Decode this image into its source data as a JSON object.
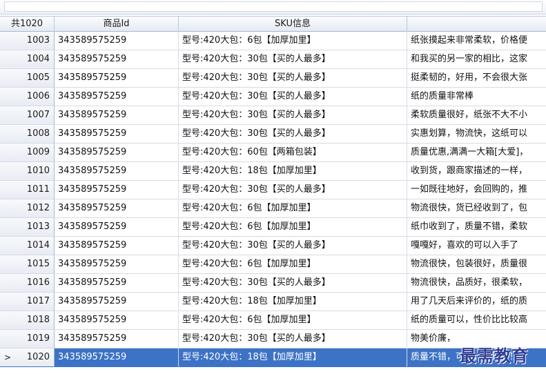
{
  "header": {
    "corner": "共1020",
    "columns": [
      "商品Id",
      "SKU信息",
      ""
    ]
  },
  "selected_row_marker": ">",
  "rows": [
    {
      "idx": "1003",
      "product_id": "343589575259",
      "sku": "型号:420大包：6包【加厚加里】",
      "comment": "纸张摸起来非常柔软，价格便"
    },
    {
      "idx": "1004",
      "product_id": "343589575259",
      "sku": "型号:420大包：30包【买的人最多】",
      "comment": "和我买的另一家的相比，这家"
    },
    {
      "idx": "1005",
      "product_id": "343589575259",
      "sku": "型号:420大包：30包【买的人最多】",
      "comment": "挺柔韧的，好用，不会很大张"
    },
    {
      "idx": "1006",
      "product_id": "343589575259",
      "sku": "型号:420大包：30包【买的人最多】",
      "comment": "纸的质量非常棒"
    },
    {
      "idx": "1007",
      "product_id": "343589575259",
      "sku": "型号:420大包：30包【买的人最多】",
      "comment": "柔软质量很好，纸张不大不小"
    },
    {
      "idx": "1008",
      "product_id": "343589575259",
      "sku": "型号:420大包：30包【买的人最多】",
      "comment": "实惠划算，物流快，这纸可以"
    },
    {
      "idx": "1009",
      "product_id": "343589575259",
      "sku": "型号:420大包：60包【两箱包装】",
      "comment": "质量优惠,满满一大箱[大爱]，"
    },
    {
      "idx": "1010",
      "product_id": "343589575259",
      "sku": "型号:420大包：18包【加厚加里】",
      "comment": "收到货，跟商家描述的一样，"
    },
    {
      "idx": "1011",
      "product_id": "343589575259",
      "sku": "型号:420大包：30包【买的人最多】",
      "comment": "一如既往地好，会回购的，推"
    },
    {
      "idx": "1012",
      "product_id": "343589575259",
      "sku": "型号:420大包：6包【加厚加里】",
      "comment": "物流很快，货已经收到了，包"
    },
    {
      "idx": "1013",
      "product_id": "343589575259",
      "sku": "型号:420大包：6包【加厚加里】",
      "comment": "纸巾收到了，质量不错，柔软"
    },
    {
      "idx": "1014",
      "product_id": "343589575259",
      "sku": "型号:420大包：30包【买的人最多】",
      "comment": "嘎嘎好，喜欢的可以入手了"
    },
    {
      "idx": "1015",
      "product_id": "343589575259",
      "sku": "型号:420大包：6包【加厚加里】",
      "comment": "物流很快，包装很好，质量很"
    },
    {
      "idx": "1016",
      "product_id": "343589575259",
      "sku": "型号:420大包：30包【买的人最多】",
      "comment": "物流很快，品质好，很柔软，"
    },
    {
      "idx": "1017",
      "product_id": "343589575259",
      "sku": "型号:420大包：18包【加厚加里】",
      "comment": "用了几天后来评价的，纸的质"
    },
    {
      "idx": "1018",
      "product_id": "343589575259",
      "sku": "型号:420大包：6包【加厚加里】",
      "comment": "纸的质量可以，性价比比较高"
    },
    {
      "idx": "1019",
      "product_id": "343589575259",
      "sku": "型号:420大包：30包【买的人最多】",
      "comment": "物美价廉，"
    },
    {
      "idx": "1020",
      "product_id": "343589575259",
      "sku": "型号:420大包：18包【加厚加里】",
      "comment": "质量不错，可以，量很足！",
      "selected": true
    }
  ],
  "watermark": "最需教育"
}
